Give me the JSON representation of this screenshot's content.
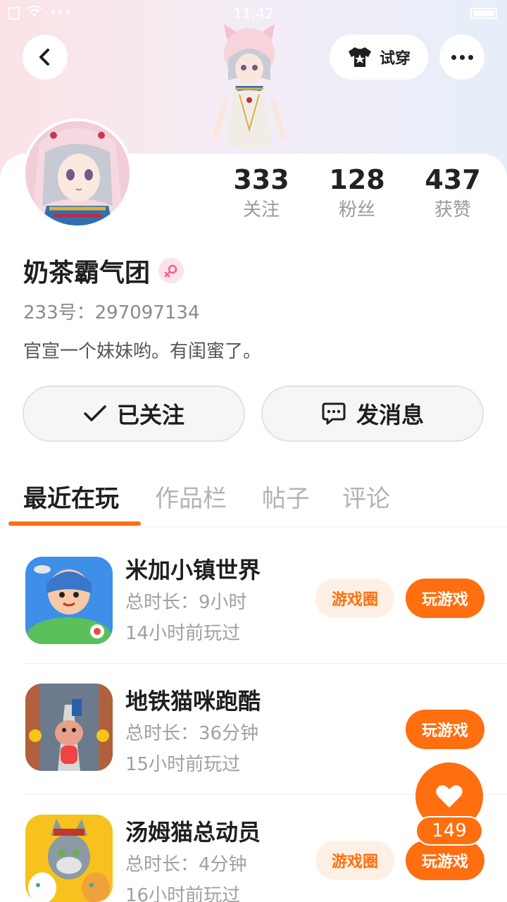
{
  "status_bar": {
    "time": "11:42"
  },
  "header": {
    "try_on_label": "试穿"
  },
  "profile": {
    "name": "奶茶霸气团",
    "uid_label": "233号：",
    "uid": "297097134",
    "bio": "官宣一个妹妹哟。有闺蜜了。",
    "stats": [
      {
        "value": "333",
        "label": "关注"
      },
      {
        "value": "128",
        "label": "粉丝"
      },
      {
        "value": "437",
        "label": "获赞"
      }
    ]
  },
  "actions": {
    "follow_label": "已关注",
    "message_label": "发消息"
  },
  "tabs": [
    {
      "label": "最近在玩",
      "active": true
    },
    {
      "label": "作品栏",
      "active": false
    },
    {
      "label": "帖子",
      "active": false
    },
    {
      "label": "评论",
      "active": false
    }
  ],
  "games": [
    {
      "title": "米加小镇世界",
      "duration": "总时长：9小时",
      "last_played": "14小时前玩过",
      "circle_label": "游戏圈",
      "play_label": "玩游戏",
      "has_circle": true
    },
    {
      "title": "地铁猫咪跑酷",
      "duration": "总时长：36分钟",
      "last_played": "15小时前玩过",
      "circle_label": "",
      "play_label": "玩游戏",
      "has_circle": false
    },
    {
      "title": "汤姆猫总动员",
      "duration": "总时长：4分钟",
      "last_played": "16小时前玩过",
      "circle_label": "游戏圈",
      "play_label": "玩游戏",
      "has_circle": true
    }
  ],
  "like": {
    "count": "149"
  },
  "colors": {
    "accent": "#ff6e0f",
    "accent_light": "#fff0e5",
    "text_primary": "#1f1f1f",
    "text_secondary": "#a0a0a0"
  },
  "icons": [
    "back-arrow-icon",
    "tshirt-icon",
    "more-dots-icon",
    "female-icon",
    "check-icon",
    "chat-bubble-icon",
    "heart-icon"
  ]
}
